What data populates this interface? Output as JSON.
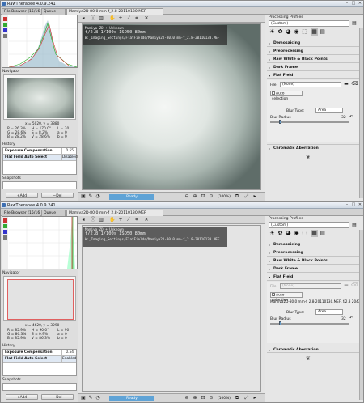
{
  "app_title": "RawTherapee 4.0.9.241",
  "tabs": {
    "file_browser": "File Browser (15/16)",
    "queue": "Queue",
    "editor": "Mamiya2D-80.0 mm-f_2.8-20110130.MEF"
  },
  "nav_label": "Navigator",
  "history_label": "History",
  "snapshots_label": "Snapshots",
  "add_label": "Add",
  "del_label": "Del",
  "ready_label": "Ready",
  "zoom_label": "(100%)",
  "processing_profiles_label": "Processing Profiles",
  "profile_value": "(Custom)",
  "tools": {
    "demosaicing": "Demosaicing",
    "preprocessing": "Preprocessing",
    "raw_wb": "Raw White & Black Points",
    "dark_frame": "Dark Frame",
    "flat_field": "Flat Field",
    "chromatic": "Chromatic Aberration"
  },
  "ff": {
    "file_label": "File",
    "blur_type_label": "Blur Type:",
    "blur_radius_label": "Blur Radius",
    "auto_select_label": "Auto selection",
    "blur_type": "Area",
    "blur_radius": "32"
  },
  "w1": {
    "overlay": {
      "l1": "Mamiya ZD + Unknown",
      "l2": "f/2.8  1/100s  ISO50  80mm",
      "l3": "W:_Imaging_Settings/FlatFields/Mamiya2D-80.0 mm-f_2.8-20110130.MEF"
    },
    "info": {
      "coords": "x = 5020, y = 3880",
      "r": "R = 26.3%",
      "g": "G = 28.6%",
      "b": "B = 28.2%",
      "h": "H = 170.0°",
      "s": "S = 8.2%",
      "v": "V = 28.6%",
      "l": "L = 30",
      "a": "a = 0",
      "bb": "b = 0"
    },
    "history_rows": [
      {
        "k": "Exposure Compensation",
        "v": "0.55"
      },
      {
        "k": "Flat Field Auto Select",
        "v": "Disabled"
      }
    ],
    "ff_file": "(None)",
    "ff_auto_checked": false,
    "ff_auto_text": ""
  },
  "w2": {
    "overlay": {
      "l1": "Mamiya ZD + Unknown",
      "l2": "f/2.8  1/100s  ISO50  80mm",
      "l3": "W:_Imaging_Settings/FlatFields/Mamiya2D-80.0 mm-f_2.8-20110130.MEF"
    },
    "info": {
      "coords": "x = 4620, y = 3290",
      "r": "R = 85.9%",
      "g": "G = 86.3%",
      "b": "B = 85.9%",
      "h": "H = 90.0°",
      "s": "S = 0.9%",
      "v": "V = 86.3%",
      "l": "L = 90",
      "a": "a = 0",
      "bb": "b = 0"
    },
    "history_rows": [
      {
        "k": "Exposure Compensation",
        "v": "0.54"
      },
      {
        "k": "Flat Field Auto Select",
        "v": "Enabled"
      }
    ],
    "ff_file": "(None)",
    "ff_auto_checked": true,
    "ff_auto_text": "Mamiya2D-80.0 mm-f_2.8-20110130.MEF, f/2.8 2043"
  },
  "colors": {
    "ready": "#5fa3d6",
    "accent": "#3d6fb2"
  }
}
